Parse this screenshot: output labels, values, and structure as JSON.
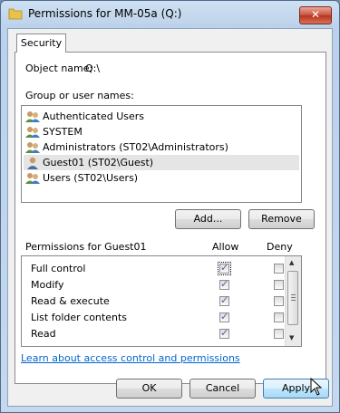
{
  "window": {
    "title": "Permissions for MM-05a (Q:)",
    "close_label": "✕"
  },
  "tabs": [
    {
      "label": "Security"
    }
  ],
  "object": {
    "label": "Object name:",
    "value": "Q:\\"
  },
  "group_label": "Group or user names:",
  "users": [
    {
      "name": "Authenticated Users",
      "selected": false
    },
    {
      "name": "SYSTEM",
      "selected": false
    },
    {
      "name": "Administrators (ST02\\Administrators)",
      "selected": false
    },
    {
      "name": "Guest01 (ST02\\Guest)",
      "selected": true
    },
    {
      "name": "Users (ST02\\Users)",
      "selected": false
    }
  ],
  "buttons": {
    "add": "Add...",
    "remove": "Remove",
    "ok": "OK",
    "cancel": "Cancel",
    "apply": "Apply"
  },
  "permissions": {
    "header": "Permissions for Guest01",
    "allow_col": "Allow",
    "deny_col": "Deny",
    "rows": [
      {
        "name": "Full control",
        "allow": true,
        "deny": false
      },
      {
        "name": "Modify",
        "allow": true,
        "deny": false
      },
      {
        "name": "Read & execute",
        "allow": true,
        "deny": false
      },
      {
        "name": "List folder contents",
        "allow": true,
        "deny": false
      },
      {
        "name": "Read",
        "allow": true,
        "deny": false
      }
    ]
  },
  "link": "Learn about access control and permissions",
  "colors": {
    "accent": "#0066cc",
    "selection": "#e5e5e5"
  }
}
